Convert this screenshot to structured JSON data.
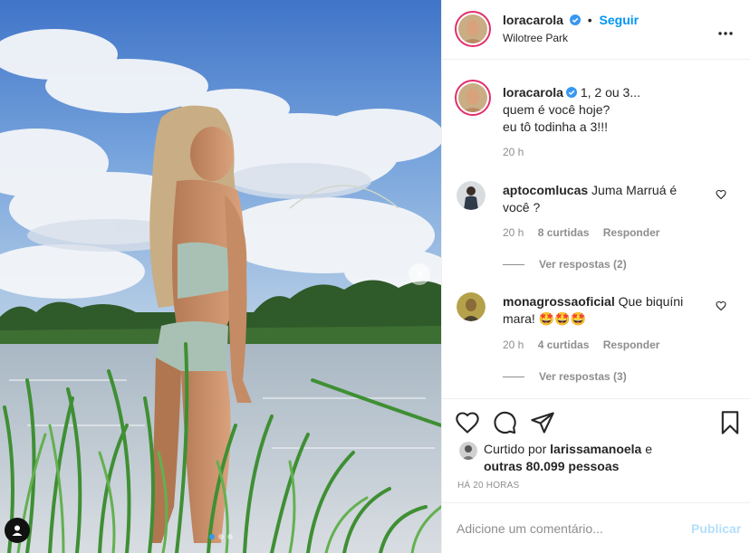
{
  "post": {
    "author": "loracarola",
    "follow_label": "Seguir",
    "location": "Wilotree Park",
    "caption_lines": [
      "1, 2 ou 3...",
      "quem é você hoje?",
      "eu tô todinha a 3!!!"
    ],
    "caption_time": "20 h"
  },
  "comments": [
    {
      "user": "aptocomlucas",
      "text_line1": "Juma Marruá é",
      "text_line2": "você ?",
      "time": "20 h",
      "likes": "8 curtidas",
      "reply_label": "Responder",
      "view_replies": "Ver respostas (2)"
    },
    {
      "user": "monagrossaoficial",
      "text_line1": "Que biquíni",
      "text_line2": "mara! 🤩🤩🤩",
      "time": "20 h",
      "likes": "4 curtidas",
      "reply_label": "Responder",
      "view_replies": "Ver respostas (3)"
    }
  ],
  "likes": {
    "prefix": "Curtido por",
    "liker": "larissamanoela",
    "conj": "e",
    "others": "outras 80.099 pessoas"
  },
  "timestamp": "HÁ 20 HORAS",
  "comment_box": {
    "placeholder": "Adicione um comentário...",
    "publish_label": "Publicar"
  },
  "carousel": {
    "slides": 3,
    "active": 1
  },
  "colors": {
    "follow": "#0095f6",
    "story_ring": "#e1306c",
    "publish_disabled": "#b2dffc",
    "active_dot": "#2e9af0"
  },
  "icons": [
    "heart-icon",
    "comment-icon",
    "share-icon",
    "bookmark-icon",
    "more-options-icon",
    "verified-icon",
    "chevron-right-icon",
    "user-tag-icon"
  ]
}
